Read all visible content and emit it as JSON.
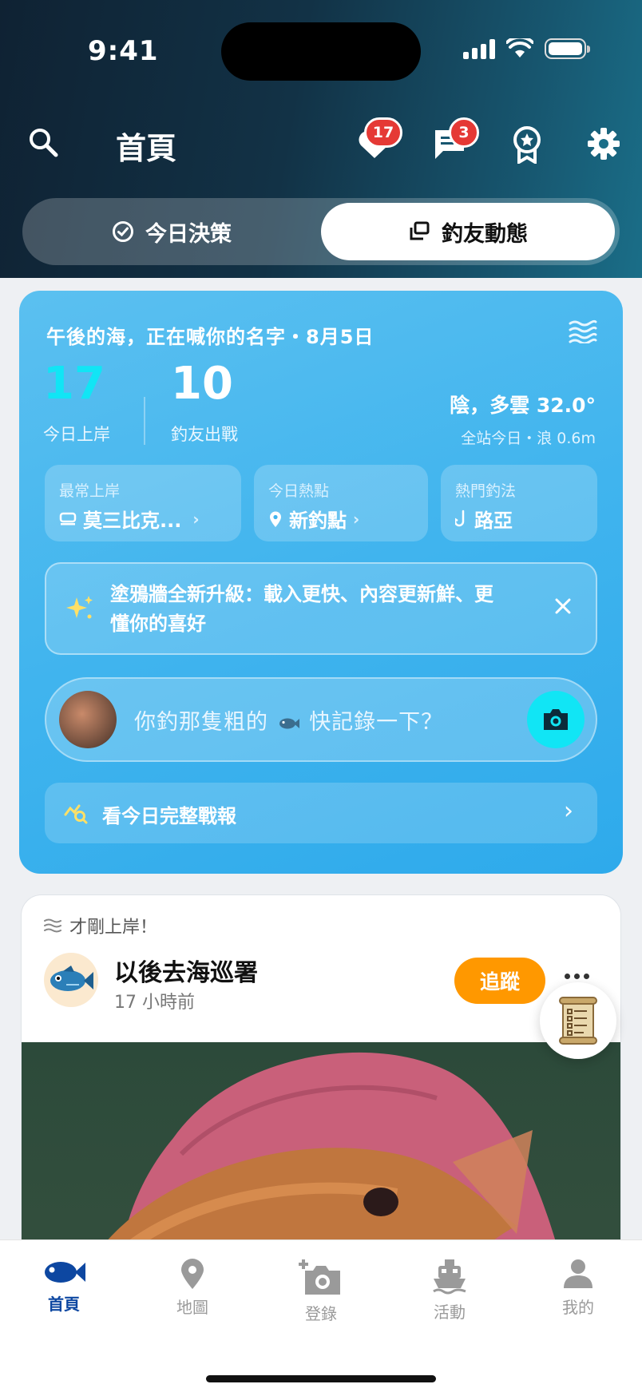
{
  "status": {
    "time": "9:41"
  },
  "header": {
    "title": "首頁",
    "likes_badge": "17",
    "messages_badge": "3"
  },
  "segments": {
    "left": "今日決策",
    "right": "釣友動態"
  },
  "hero": {
    "greeting": "午後的海，正在喊你的名字・8月5日",
    "stat1_value": "17",
    "stat1_label": "今日上岸",
    "stat2_value": "10",
    "stat2_label": "釣友出戰",
    "weather": "陰，多雲 32.0°",
    "weather_sub": "全站今日・浪 0.6m",
    "chips": [
      {
        "label": "最常上岸",
        "value": "莫三比克...",
        "icon": "species-icon"
      },
      {
        "label": "今日熱點",
        "value": "新釣點",
        "icon": "location-pin-icon"
      },
      {
        "label": "熱門釣法",
        "value": "路亞",
        "icon": "hook-icon"
      }
    ],
    "notice": "塗鴉牆全新升級：載入更快、內容更新鮮、更懂你的喜好",
    "composer_placeholder_a": "你釣那隻粗的",
    "composer_placeholder_b": "快記錄一下？",
    "report_label": "看今日完整戰報"
  },
  "post": {
    "tag": "才剛上岸！",
    "user": "以後去海巡署",
    "time": "17 小時前",
    "follow_label": "追蹤"
  },
  "tabs": [
    {
      "label": "首頁",
      "icon": "fish-icon",
      "active": true
    },
    {
      "label": "地圖",
      "icon": "map-pin-icon",
      "active": false
    },
    {
      "label": "登錄",
      "icon": "add-camera-icon",
      "active": false
    },
    {
      "label": "活動",
      "icon": "boat-icon",
      "active": false
    },
    {
      "label": "我的",
      "icon": "person-icon",
      "active": false
    }
  ],
  "colors": {
    "accent_blue": "#40b4ee",
    "cyan": "#11e5f5",
    "follow_orange": "#ff9800",
    "tab_active": "#0d47a1",
    "badge_red": "#e53935"
  }
}
